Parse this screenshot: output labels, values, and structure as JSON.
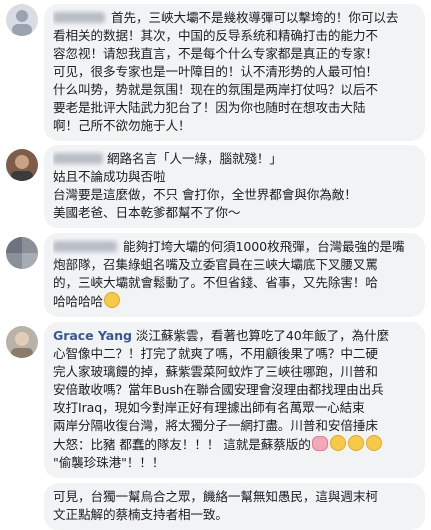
{
  "comments": [
    {
      "author": "",
      "lines": [
        "首先，三峽大壩不是幾枚導彈可以擊垮的！你可以去",
        "看相关的数据！其次，中国的反导系统和精确打击的能力不",
        "容忽视！请恕我直言，不是每个什么专家都是真正的专家！",
        "可见，很多专家也是一叶障目的！认不清形势的人最可怕！",
        "什么叫势，势就是氛围！现在的氛围是两岸打仗吗？以后不",
        "要老是批评大陆武力犯台了！因为你也随时在想攻击大陆",
        "啊！己所不欲勿施于人！"
      ]
    },
    {
      "author": "",
      "lines": [
        "網路名言「人一綠，腦就殘！」",
        "姑且不論成功與否啦",
        "台灣要是這麼做，不只 會打你，全世界都會與你為敵！",
        "美國老爸、日本乾爹都幫不了你～"
      ]
    },
    {
      "author": "",
      "lines": [
        "能夠打垮大壩的何須1000枚飛彈，台灣最強的是嘴",
        "炮部隊，召集綠蛆名嘴及立委官員在三峽大壩底下叉腰叉罵",
        "的，三峽大壩就會鬆動了。不但省錢、省事，又先除害！哈",
        "哈哈哈哈"
      ]
    },
    {
      "author": "Grace Yang",
      "lines": [
        "淡江蘇紫雲，看著也算吃了40年飯了，為什麼",
        "心智像中二？！打完了就爽了嗎，不用顧後果了嗎？中二硬",
        "完人家玻璃饅的掉，蘇紫雲菜阿蚊炸了三峽往哪跑，川普和",
        "安倍敢收嗎？當年Bush在聯合國安理會沒理由都找理由出兵",
        "攻打Iraq，現如今對岸正好有理據出師有名萬眾一心結束",
        "兩岸分隔收復台灣，將太獨分子一網打盡。川普和安倍捶床",
        "大怒：比豬 都蠢的隊友！！！ 這就是蘇蔡版的",
        "\"偷襲珍珠港\"！！！"
      ]
    },
    {
      "author": "",
      "lines": [
        "可見，台獨一幫烏合之眾，饑絡一幫無知愚民，這與週末柯",
        "文正點解的蔡楠支持者相一致。"
      ]
    }
  ]
}
